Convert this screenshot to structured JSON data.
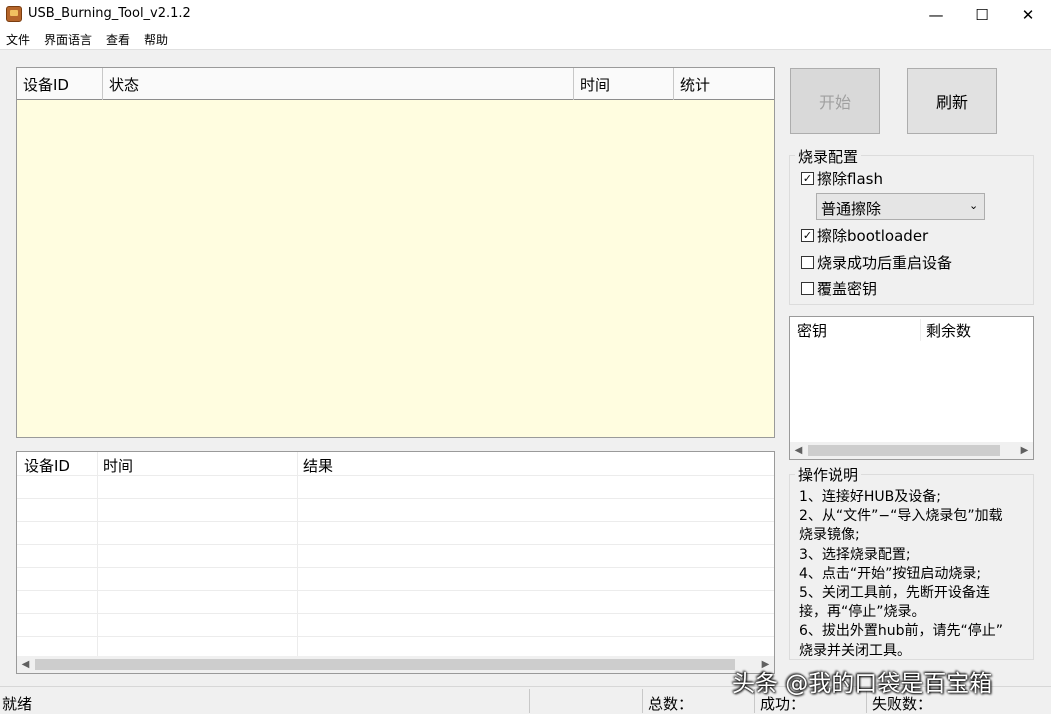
{
  "window": {
    "title": "USB_Burning_Tool_v2.1.2",
    "minimize_glyph": "—",
    "maximize_glyph": "☐",
    "close_glyph": "✕"
  },
  "menu": [
    "文件",
    "界面语言",
    "查看",
    "帮助"
  ],
  "device_table": {
    "columns": [
      "设备ID",
      "状态",
      "时间",
      "统计"
    ],
    "background": "#fffde0"
  },
  "result_table": {
    "columns": [
      "设备ID",
      "时间",
      "结果"
    ]
  },
  "buttons": {
    "start": "开始",
    "refresh": "刷新"
  },
  "burn_config": {
    "title": "烧录配置",
    "erase_flash": {
      "label": "擦除flash",
      "checked": true
    },
    "erase_mode": {
      "selected": "普通擦除"
    },
    "erase_bootloader": {
      "label": "擦除bootloader",
      "checked": true
    },
    "reboot_after": {
      "label": "烧录成功后重启设备",
      "checked": false
    },
    "overwrite_key": {
      "label": "覆盖密钥",
      "checked": false
    }
  },
  "key_list": {
    "columns": [
      "密钥",
      "剩余数"
    ]
  },
  "instructions": {
    "title": "操作说明",
    "lines": [
      "1、连接好HUB及设备;",
      "2、从“文件”−“导入烧录包”加载",
      "烧录镜像;",
      "3、选择烧录配置;",
      "4、点击“开始”按钮启动烧录;",
      "5、关闭工具前，先断开设备连",
      "接，再“停止”烧录。",
      "6、拔出外置hub前，请先“停止”",
      "烧录并关闭工具。"
    ]
  },
  "status": {
    "state": "就绪",
    "total_label": "总数：",
    "success_label": "成功：",
    "fail_label": "失败数："
  },
  "watermark": "头条 @我的口袋是百宝箱",
  "check_mark": "✓"
}
